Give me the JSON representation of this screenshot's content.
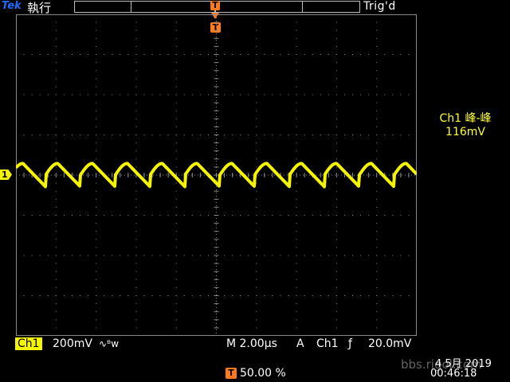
{
  "header": {
    "brand": "Tek",
    "run_state": "執行",
    "trigger_status": "Trig'd",
    "record_marker": "T",
    "trigger_marker": "T"
  },
  "measurement": {
    "label": "Ch1 峰-峰",
    "value": "116mV"
  },
  "channel_marker": "1",
  "status": {
    "channel": "Ch1",
    "volts_per_div": "200mV",
    "coupling_symbol": "∿ᴮw",
    "timebase": "M 2.00µs",
    "trigger_mode": "A",
    "trigger_source": "Ch1",
    "trigger_slope": "ƒ",
    "trigger_level": "20.0mV"
  },
  "trigger_position": {
    "icon": "T",
    "value": "50.00 %"
  },
  "datetime": {
    "date": "4 5月  2019",
    "time": "00:46:18"
  },
  "watermark": "bbs.rigol.com",
  "waveform": {
    "color": "#f5f500",
    "offset_div": 0.0,
    "amplitude_mv_pp": 116,
    "cycles_on_screen": 11.5
  },
  "colors": {
    "channel": "#f5f500",
    "trigger": "#ff7a1a",
    "brand": "#1f6bff",
    "grid": "#8a8a8a"
  }
}
